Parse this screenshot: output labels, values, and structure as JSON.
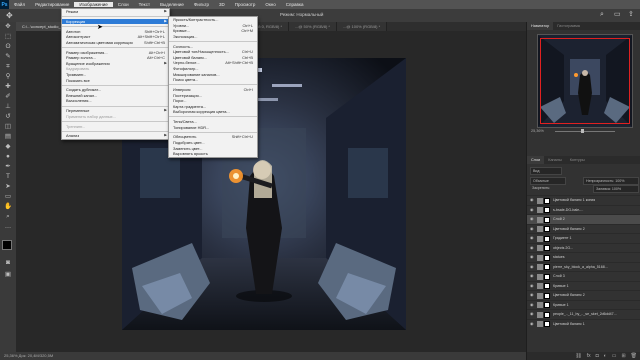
{
  "menubar": {
    "items": [
      "Файл",
      "Редактирование",
      "Изображение",
      "Слои",
      "Текст",
      "Выделение",
      "Фильтр",
      "3D",
      "Просмотр",
      "Окно",
      "Справка"
    ],
    "active_index": 2
  },
  "options": {
    "mode_label": "Режим: Нормальный"
  },
  "tabs": [
    {
      "label": "C:\\...\\concept_studio_29 @ 25,3% (Слой 1, RGB/8) *"
    },
    {
      "label": "Безымянный-1 @ 100% (Слой 1, RGB/8) *"
    },
    {
      "label": "ss.jpg @ 66,7% (Слой 0, RGB/8) *"
    },
    {
      "label": "...@ 50% (RGB/8) *"
    },
    {
      "label": "...@ 100% (RGB/8) *"
    }
  ],
  "status_text": "25,36%   Док: 20,4M/320,5M",
  "panels": {
    "nav_tabs": [
      "Навигатор",
      "Гистограмма"
    ],
    "zoom_value": "25,36%",
    "layer_tabs": [
      "Слои",
      "Каналы",
      "Контуры"
    ],
    "filter_label": "Вид",
    "blend_mode": "Обычные",
    "opacity_label": "Непрозрачность: 100%",
    "lock_label": "Закрепить:",
    "fill_label": "Заливка: 100%"
  },
  "layers": [
    {
      "name": "Цветовой баланс 1 копия",
      "selected": false
    },
    {
      "name": "s-bsale-DG-bale-...",
      "selected": false
    },
    {
      "name": "Слой 2",
      "selected": true
    },
    {
      "name": "Цветовой баланс 2",
      "selected": false
    },
    {
      "name": "Градиент 1",
      "selected": false
    },
    {
      "name": "objects 2G...",
      "selected": false
    },
    {
      "name": "statues",
      "selected": false
    },
    {
      "name": "pierre_sky_block_a_alpha_5168...",
      "selected": false
    },
    {
      "name": "Слой 3",
      "selected": false
    },
    {
      "name": "Кривые 1",
      "selected": false
    },
    {
      "name": "Цветовой баланс 2",
      "selected": false
    },
    {
      "name": "Кривые 1",
      "selected": false
    },
    {
      "name": "people_.._11_by_.._se_sket_2d6dd47...",
      "selected": false
    },
    {
      "name": "Цветовой баланс 1",
      "selected": false
    }
  ],
  "image_menu": {
    "items": [
      {
        "label": "Режим",
        "sub": true
      },
      {
        "sep": true
      },
      {
        "label": "Коррекция",
        "sub": true,
        "hl": true
      },
      {
        "sep": true
      },
      {
        "label": "Автотон",
        "sc": "Shift+Ctrl+L"
      },
      {
        "label": "Автоконтраст",
        "sc": "Alt+Shift+Ctrl+L"
      },
      {
        "label": "Автоматическая цветовая коррекция",
        "sc": "Shift+Ctrl+B"
      },
      {
        "sep": true
      },
      {
        "label": "Размер изображения...",
        "sc": "Alt+Ctrl+I"
      },
      {
        "label": "Размер холста...",
        "sc": "Alt+Ctrl+C"
      },
      {
        "label": "Вращение изображения",
        "sub": true
      },
      {
        "label": "Кадрировать",
        "dis": true
      },
      {
        "label": "Тримминг..."
      },
      {
        "label": "Показать все"
      },
      {
        "sep": true
      },
      {
        "label": "Создать дубликат..."
      },
      {
        "label": "Внешний канал..."
      },
      {
        "label": "Вычисления..."
      },
      {
        "sep": true
      },
      {
        "label": "Переменные",
        "sub": true
      },
      {
        "label": "Применить набор данных...",
        "dis": true
      },
      {
        "sep": true
      },
      {
        "label": "Треппинг...",
        "dis": true
      },
      {
        "sep": true
      },
      {
        "label": "Анализ",
        "sub": true
      }
    ]
  },
  "adjust_menu": {
    "items": [
      {
        "label": "Яркость/Контрастность..."
      },
      {
        "label": "Уровни...",
        "sc": "Ctrl+L"
      },
      {
        "label": "Кривые...",
        "sc": "Ctrl+M"
      },
      {
        "label": "Экспозиция..."
      },
      {
        "sep": true
      },
      {
        "label": "Сочность..."
      },
      {
        "label": "Цветовой тон/Насыщенность...",
        "sc": "Ctrl+U"
      },
      {
        "label": "Цветовой баланс...",
        "sc": "Ctrl+B"
      },
      {
        "label": "Черно-белое...",
        "sc": "Alt+Shift+Ctrl+B"
      },
      {
        "label": "Фотофильтр..."
      },
      {
        "label": "Микширование каналов..."
      },
      {
        "label": "Поиск цвета..."
      },
      {
        "sep": true
      },
      {
        "label": "Инверсия",
        "sc": "Ctrl+I"
      },
      {
        "label": "Постеризация..."
      },
      {
        "label": "Порог..."
      },
      {
        "label": "Карта градиента..."
      },
      {
        "label": "Выборочная коррекция цвета..."
      },
      {
        "sep": true
      },
      {
        "label": "Тени/Света..."
      },
      {
        "label": "Тонирование HDR..."
      },
      {
        "sep": true
      },
      {
        "label": "Обесцветить",
        "sc": "Shift+Ctrl+U"
      },
      {
        "label": "Подобрать цвет..."
      },
      {
        "label": "Заменить цвет..."
      },
      {
        "label": "Выровнять яркость"
      }
    ]
  }
}
